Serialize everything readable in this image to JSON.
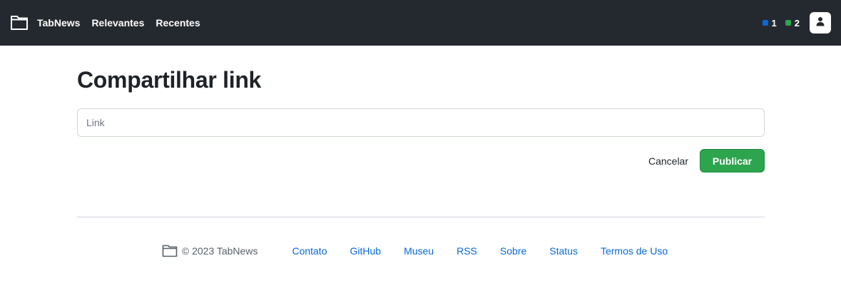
{
  "header": {
    "brand": "TabNews",
    "nav": [
      "Relevantes",
      "Recentes"
    ],
    "counters": [
      {
        "value": "1",
        "color": "#0969da"
      },
      {
        "value": "2",
        "color": "#2da44e"
      }
    ]
  },
  "main": {
    "title": "Compartilhar link",
    "link_placeholder": "Link",
    "link_value": "",
    "cancel_label": "Cancelar",
    "publish_label": "Publicar"
  },
  "footer": {
    "copyright": "© 2023 TabNews",
    "links": [
      "Contato",
      "GitHub",
      "Museu",
      "RSS",
      "Sobre",
      "Status",
      "Termos de Uso"
    ]
  },
  "icons": {
    "logo": "folder-icon",
    "avatar": "user-icon"
  }
}
